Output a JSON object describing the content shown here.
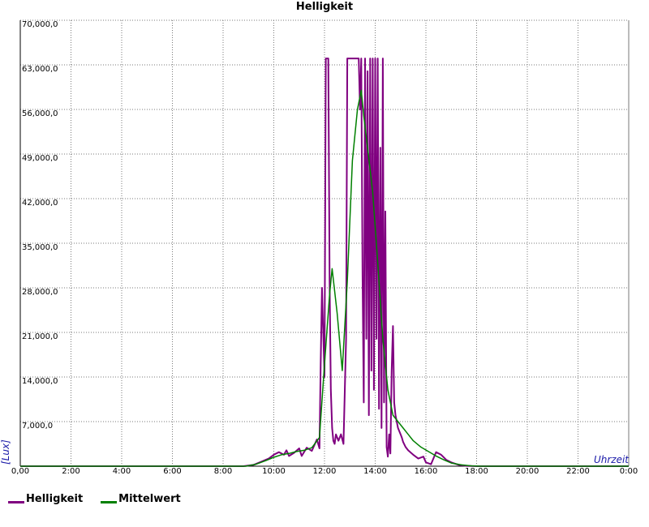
{
  "chart_data": {
    "type": "line",
    "title": "Helligkeit",
    "xlabel": "Uhrzeit",
    "ylabel": "[Lux]",
    "xlim": [
      0,
      24
    ],
    "ylim": [
      0,
      70000
    ],
    "grid": true,
    "legend_position": "bottom-left",
    "x_ticks": [
      "0,00",
      "2:00",
      "4:00",
      "6:00",
      "8:00",
      "10:00",
      "12:00",
      "14:00",
      "16:00",
      "18:00",
      "20:00",
      "22:00",
      "0:00"
    ],
    "y_ticks": [
      "7,000,0",
      "14,000,0",
      "21,000,0",
      "28,000,0",
      "35,000,0",
      "42,000,0",
      "49,000,0",
      "56,000,0",
      "63,000,0",
      "70,000,0"
    ],
    "series": [
      {
        "name": "Helligkeit",
        "color": "#800080",
        "x": [
          0,
          8.8,
          9.2,
          9.5,
          9.8,
          10.0,
          10.2,
          10.4,
          10.5,
          10.6,
          10.8,
          11.0,
          11.1,
          11.3,
          11.5,
          11.7,
          11.8,
          11.85,
          11.9,
          12.0,
          12.05,
          12.1,
          12.15,
          12.2,
          12.25,
          12.3,
          12.35,
          12.4,
          12.45,
          12.55,
          12.65,
          12.75,
          12.85,
          12.9,
          12.95,
          13.0,
          13.05,
          13.1,
          13.15,
          13.2,
          13.25,
          13.3,
          13.35,
          13.4,
          13.45,
          13.5,
          13.55,
          13.6,
          13.65,
          13.7,
          13.75,
          13.8,
          13.85,
          13.9,
          13.95,
          14.0,
          14.05,
          14.1,
          14.15,
          14.2,
          14.25,
          14.3,
          14.35,
          14.4,
          14.45,
          14.5,
          14.55,
          14.6,
          14.65,
          14.7,
          14.75,
          14.8,
          14.9,
          15.0,
          15.05,
          15.1,
          15.2,
          15.3,
          15.5,
          15.7,
          15.9,
          16.0,
          16.2,
          16.4,
          16.6,
          16.8,
          17.0,
          17.3,
          17.6,
          18.0,
          24
        ],
        "y": [
          0,
          0,
          200,
          700,
          1200,
          1800,
          2200,
          1800,
          2500,
          1600,
          2100,
          2800,
          1600,
          2900,
          2400,
          4200,
          2800,
          16000,
          28000,
          14000,
          64000,
          64000,
          64000,
          29000,
          12000,
          6000,
          4000,
          3500,
          5000,
          4000,
          5000,
          3500,
          20000,
          64000,
          64000,
          64000,
          64000,
          64000,
          64000,
          64000,
          64000,
          64000,
          64000,
          56000,
          64000,
          30000,
          10000,
          64000,
          20000,
          62000,
          8000,
          64000,
          15000,
          64000,
          12000,
          64000,
          20000,
          64000,
          9000,
          50000,
          6000,
          64000,
          10000,
          40000,
          3000,
          1500,
          5000,
          2000,
          15000,
          22000,
          10000,
          8000,
          6000,
          5000,
          4500,
          3800,
          3000,
          2500,
          1800,
          1200,
          1500,
          600,
          300,
          2200,
          1800,
          1000,
          600,
          200,
          50,
          0,
          0
        ]
      },
      {
        "name": "Mittelwert",
        "color": "#008000",
        "x": [
          0,
          8.9,
          9.3,
          9.7,
          10.0,
          10.3,
          10.6,
          10.9,
          11.2,
          11.5,
          11.8,
          12.0,
          12.2,
          12.3,
          12.5,
          12.7,
          12.9,
          13.1,
          13.3,
          13.45,
          13.55,
          13.7,
          13.9,
          14.1,
          14.3,
          14.5,
          14.7,
          14.9,
          15.1,
          15.3,
          15.5,
          15.8,
          16.1,
          16.4,
          16.7,
          17.0,
          17.4,
          17.8,
          18.2,
          24
        ],
        "y": [
          0,
          0,
          300,
          900,
          1400,
          1800,
          2000,
          2300,
          2500,
          2900,
          4500,
          16000,
          27000,
          31000,
          24000,
          15000,
          29000,
          48000,
          56000,
          59000,
          55000,
          50000,
          43000,
          32000,
          20000,
          12000,
          8000,
          7000,
          6000,
          5000,
          4000,
          3000,
          2300,
          1600,
          1000,
          500,
          200,
          50,
          0,
          0
        ]
      }
    ]
  }
}
